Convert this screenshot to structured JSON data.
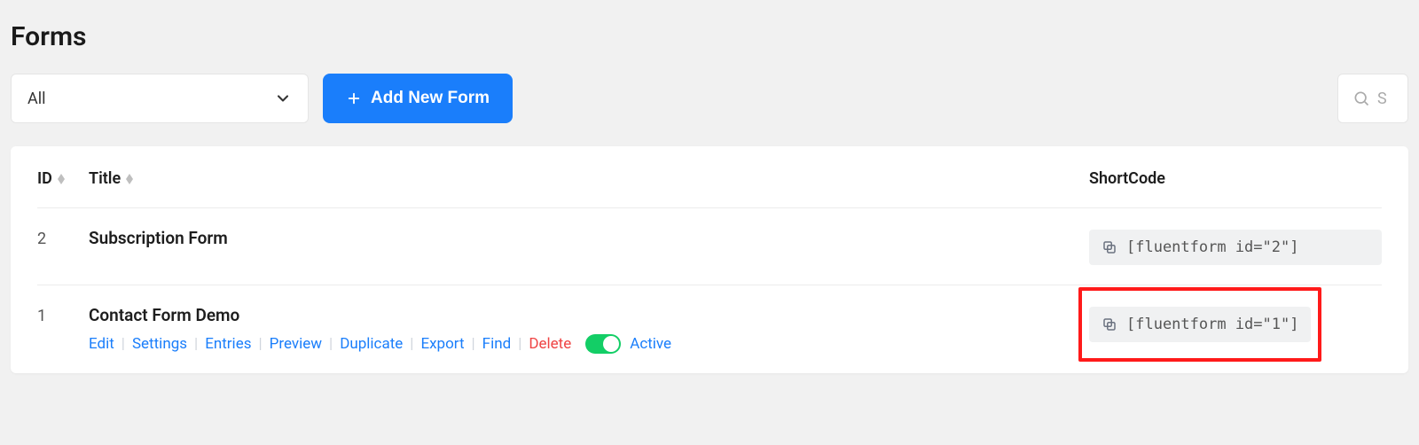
{
  "page_title": "Forms",
  "toolbar": {
    "filter_label": "All",
    "add_button": "Add New Form",
    "search_placeholder": "S"
  },
  "columns": {
    "id": "ID",
    "title": "Title",
    "shortcode": "ShortCode"
  },
  "actions": {
    "edit": "Edit",
    "settings": "Settings",
    "entries": "Entries",
    "preview": "Preview",
    "duplicate": "Duplicate",
    "export": "Export",
    "find": "Find",
    "delete": "Delete",
    "active": "Active"
  },
  "rows": [
    {
      "id": "2",
      "title": "Subscription Form",
      "shortcode": "[fluentform id=\"2\"]",
      "show_actions": false,
      "highlight": false
    },
    {
      "id": "1",
      "title": "Contact Form Demo",
      "shortcode": "[fluentform id=\"1\"]",
      "show_actions": true,
      "highlight": true
    }
  ]
}
